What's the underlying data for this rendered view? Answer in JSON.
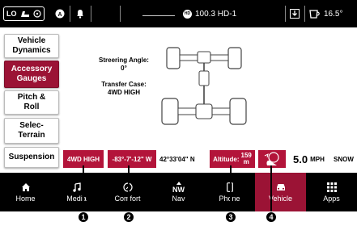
{
  "status_bar": {
    "lo_label": "LO",
    "radio_label": "100.3 HD-1",
    "hd_badge": "HD",
    "temperature": "16.5°"
  },
  "sidebar": {
    "items": [
      {
        "label": "Vehicle\nDynamics"
      },
      {
        "label": "Accessory\nGauges"
      },
      {
        "label": "Pitch &\nRoll"
      },
      {
        "label": "Selec-\nTerrain"
      },
      {
        "label": "Suspension"
      }
    ]
  },
  "diagram": {
    "steering_angle_label": "Streering Angle:",
    "steering_angle_value": "0°",
    "transfer_case_label": "Transfer Case:",
    "transfer_case_value": "4WD HIGH"
  },
  "info_strip": {
    "drive_mode": "4WD HIGH",
    "longitude": "-83°-7'-12\" W",
    "latitude": "42°33'04\" N",
    "altitude_label": "Altitude:",
    "altitude_value": "159\nm",
    "speed_value": "5.0",
    "speed_unit": "MPH",
    "mode": "SNOW"
  },
  "bottom_nav": {
    "items": [
      {
        "label": "Home",
        "icon": "home-icon"
      },
      {
        "label": "Media",
        "icon": "music-note-icon"
      },
      {
        "label": "Comfort",
        "icon": "comfort-icon"
      },
      {
        "label": "Nav",
        "icon": "compass-icon",
        "heading": "NW"
      },
      {
        "label": "Phone",
        "icon": "phone-icon"
      },
      {
        "label": "Vehicle",
        "icon": "car-icon"
      },
      {
        "label": "Apps",
        "icon": "grid-icon"
      }
    ],
    "active": "Vehicle"
  },
  "callouts": [
    "1",
    "2",
    "3",
    "4"
  ],
  "colors": {
    "accent": "#9b1335",
    "chip": "#b3143a",
    "bar": "#000000"
  }
}
